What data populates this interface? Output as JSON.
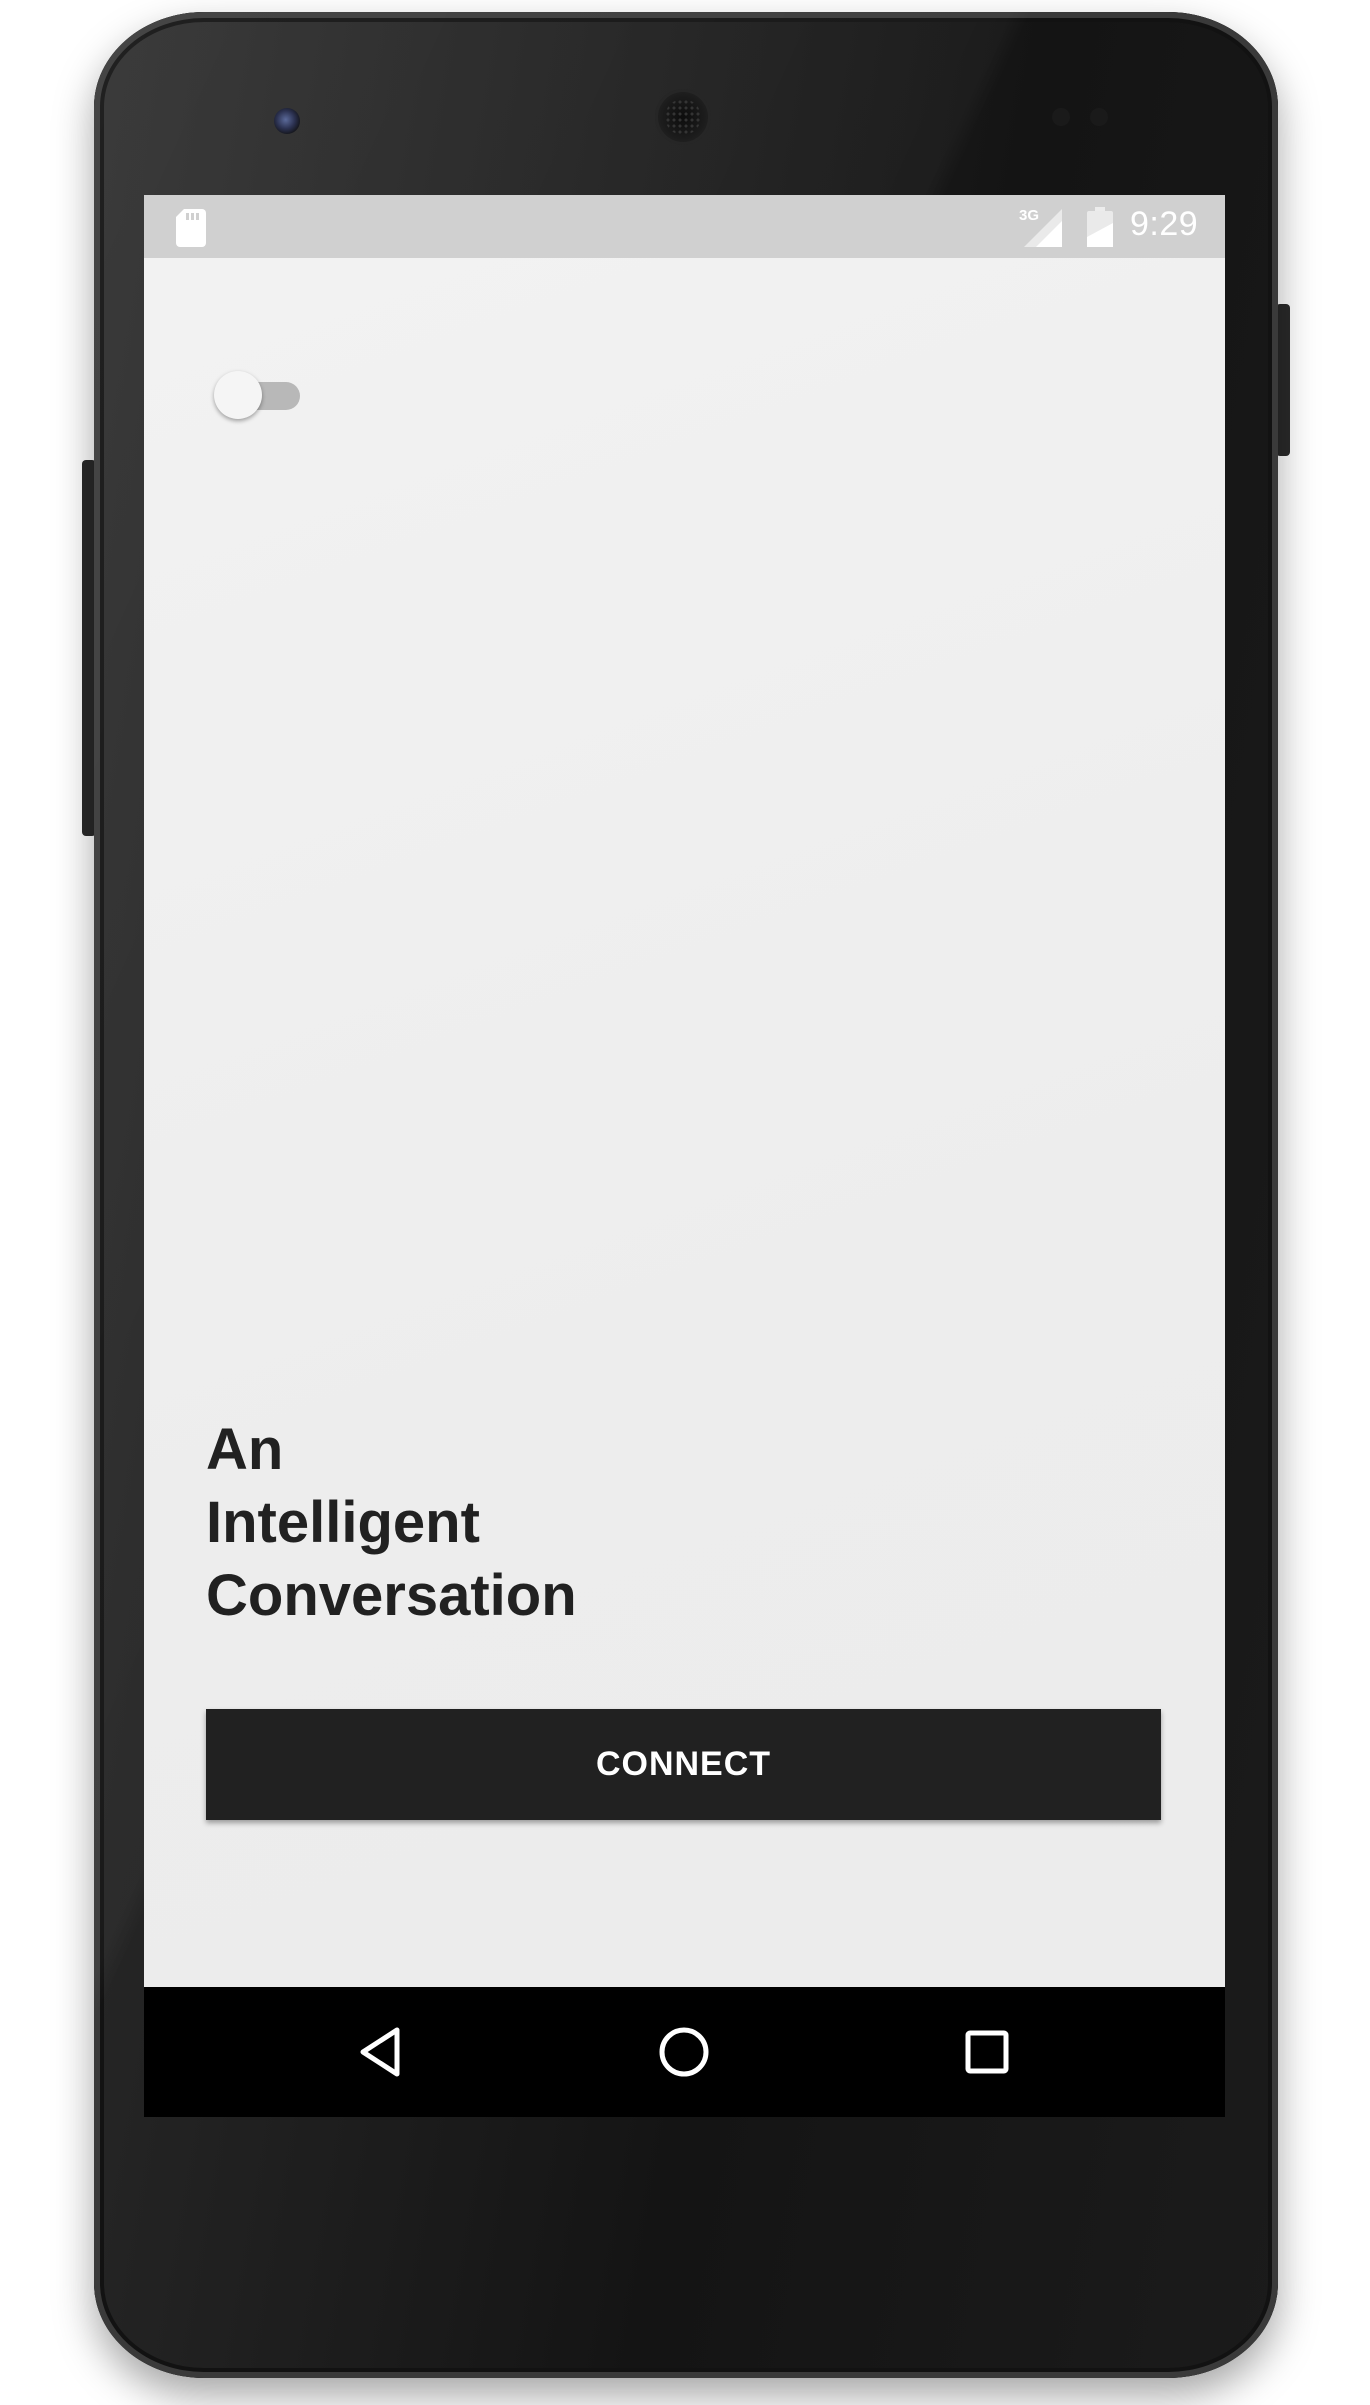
{
  "status_bar": {
    "network_type": "3G",
    "time": "9:29",
    "icons": [
      "sd-card-icon",
      "signal-icon",
      "battery-icon"
    ]
  },
  "main": {
    "toggle": {
      "state": "off"
    },
    "headline_lines": [
      "An",
      "Intelligent",
      "Conversation"
    ],
    "connect_label": "CONNECT"
  },
  "nav_bar": {
    "icons": [
      "back-icon",
      "home-icon",
      "recent-apps-icon"
    ]
  },
  "colors": {
    "screen_bg": "#eeeeee",
    "status_bar_bg": "#d0d0d0",
    "button_bg": "#212121",
    "text": "#212121",
    "nav_bar_bg": "#000000"
  }
}
